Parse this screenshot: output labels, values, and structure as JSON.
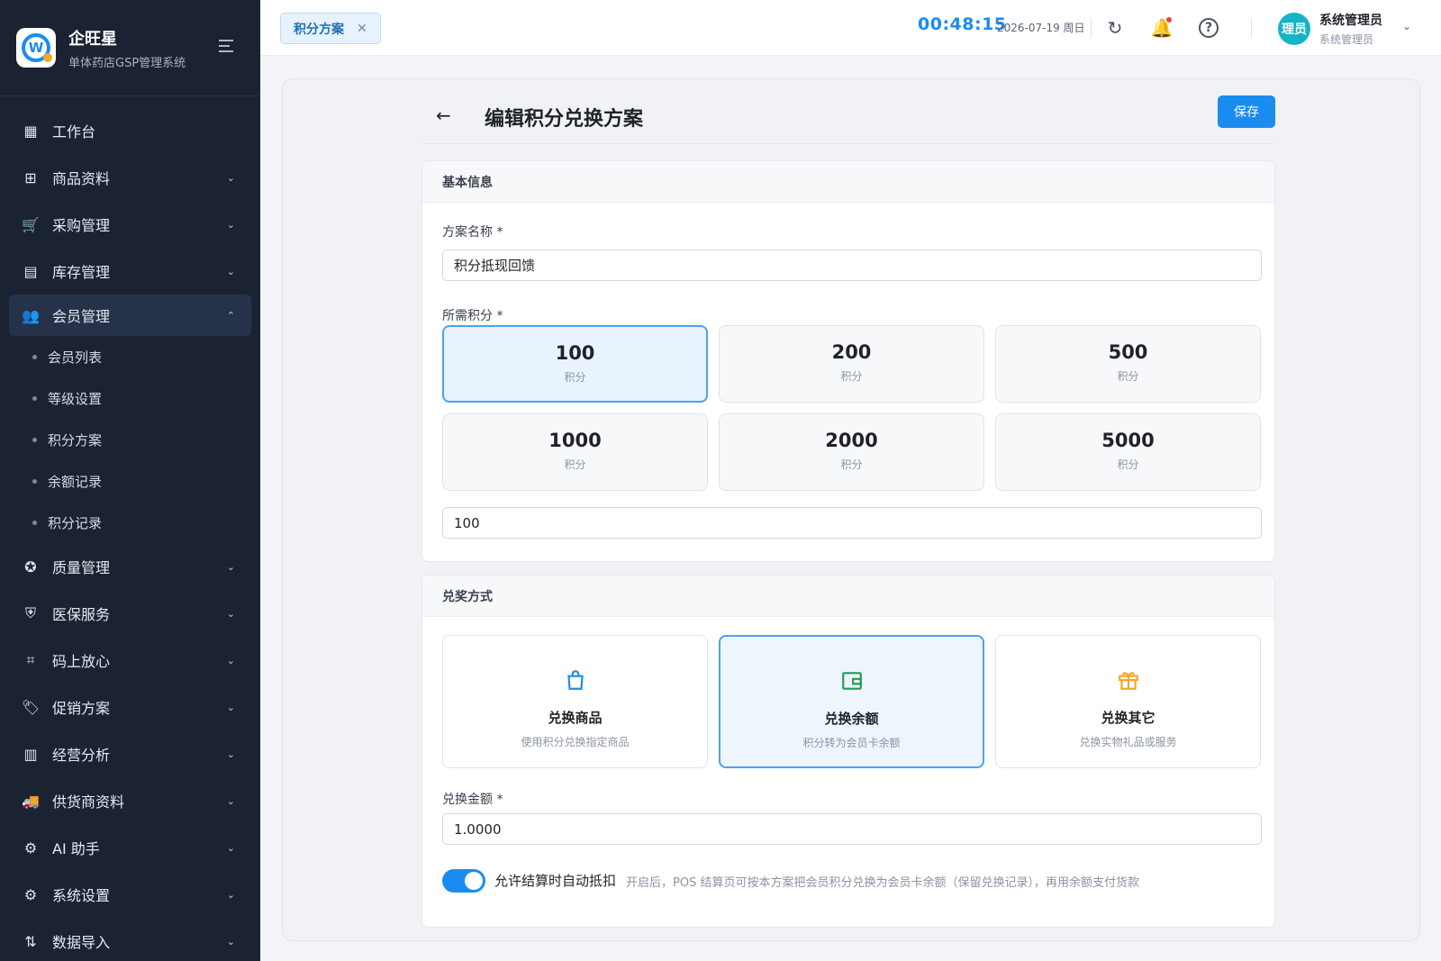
{
  "brand": {
    "name": "企旺星",
    "subtitle": "单体药店GSP管理系统",
    "logo_letter": "W"
  },
  "sidebar": {
    "items": [
      {
        "label": "工作台",
        "icon": "dashboard-icon",
        "glyph": "▦"
      },
      {
        "label": "商品资料",
        "icon": "product-icon",
        "glyph": "⊞"
      },
      {
        "label": "采购管理",
        "icon": "cart-icon",
        "glyph": "🛒"
      },
      {
        "label": "库存管理",
        "icon": "inventory-icon",
        "glyph": "▤"
      },
      {
        "label": "会员管理",
        "icon": "members-icon",
        "glyph": "👥"
      },
      {
        "label": "质量管理",
        "icon": "quality-icon",
        "glyph": "✪"
      },
      {
        "label": "医保服务",
        "icon": "insurance-icon",
        "glyph": "⛨"
      },
      {
        "label": "码上放心",
        "icon": "qrcode-icon",
        "glyph": "⌗"
      },
      {
        "label": "促销方案",
        "icon": "tag-icon",
        "glyph": "🏷"
      },
      {
        "label": "经营分析",
        "icon": "chart-icon",
        "glyph": "▥"
      },
      {
        "label": "供货商资料",
        "icon": "truck-icon",
        "glyph": "🚚"
      },
      {
        "label": "AI 助手",
        "icon": "robot-icon",
        "glyph": "⚙"
      },
      {
        "label": "系统设置",
        "icon": "settings-icon",
        "glyph": "⚙"
      },
      {
        "label": "数据导入",
        "icon": "import-icon",
        "glyph": "⇅"
      }
    ],
    "member_sub": [
      "会员列表",
      "等级设置",
      "积分方案",
      "余额记录",
      "积分记录"
    ]
  },
  "topbar": {
    "tab_label": "积分方案",
    "time": "00:48:15",
    "date": "2026-07-19 周日",
    "user_name": "系统管理员",
    "user_role": "系统管理员",
    "avatar_text": "理员"
  },
  "page": {
    "title": "编辑积分兑换方案",
    "save_label": "保存"
  },
  "basic": {
    "section_title": "基本信息",
    "name_label": "方案名称 *",
    "name_value": "积分抵现回馈",
    "points_label": "所需积分 *",
    "points_options": [
      {
        "value": "100",
        "unit": "积分",
        "selected": true
      },
      {
        "value": "200",
        "unit": "积分",
        "selected": false
      },
      {
        "value": "500",
        "unit": "积分",
        "selected": false
      },
      {
        "value": "1000",
        "unit": "积分",
        "selected": false
      },
      {
        "value": "2000",
        "unit": "积分",
        "selected": false
      },
      {
        "value": "5000",
        "unit": "积分",
        "selected": false
      }
    ],
    "points_value": "100"
  },
  "exchange": {
    "section_title": "兑奖方式",
    "modes": [
      {
        "title": "兑换商品",
        "desc": "使用积分兑换指定商品",
        "icon": "shopping-bag-icon",
        "color": "#1a8cf0",
        "selected": false
      },
      {
        "title": "兑换余额",
        "desc": "积分转为会员卡余额",
        "icon": "wallet-icon",
        "color": "#1f9d55",
        "selected": true
      },
      {
        "title": "兑换其它",
        "desc": "兑换实物礼品或服务",
        "icon": "gift-icon",
        "color": "#f5a623",
        "selected": false
      }
    ],
    "amount_label": "兑换金额 *",
    "amount_value": "1.0000",
    "auto_label": "允许结算时自动抵扣",
    "auto_hint": "开启后，POS 结算页可按本方案把会员积分兑换为会员卡余额（保留兑换记录），再用余额支付货款",
    "auto_enabled": true
  },
  "colors": {
    "accent": "#1a8cf0",
    "sidebar_bg": "#1b2333"
  }
}
